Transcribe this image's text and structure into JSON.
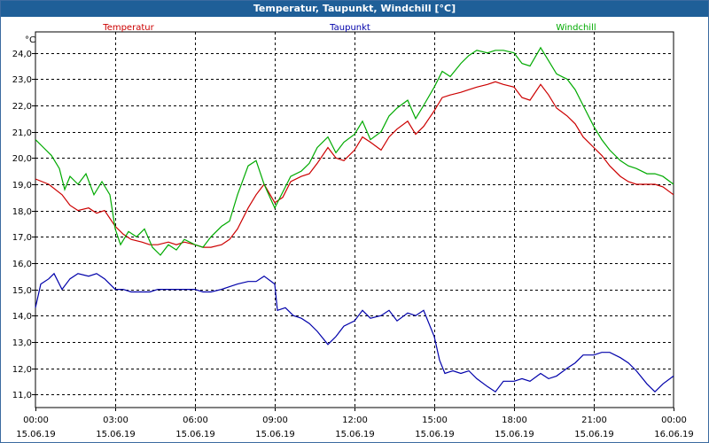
{
  "window": {
    "title": "Temperatur, Taupunkt, Windchill [°C]"
  },
  "chart_data": {
    "type": "line",
    "title": "Temperatur, Taupunkt, Windchill [°C]",
    "ylabel": "°C",
    "xlabel": "",
    "ylim": [
      10.5,
      24.8
    ],
    "y_ticks": [
      "11,0",
      "12,0",
      "13,0",
      "14,0",
      "15,0",
      "16,0",
      "17,0",
      "18,0",
      "19,0",
      "20,0",
      "21,0",
      "22,0",
      "23,0",
      "24,0"
    ],
    "x_ticks": [
      {
        "time": "00:00",
        "date": "15.06.19"
      },
      {
        "time": "03:00",
        "date": "15.06.19"
      },
      {
        "time": "06:00",
        "date": "15.06.19"
      },
      {
        "time": "09:00",
        "date": "15.06.19"
      },
      {
        "time": "12:00",
        "date": "15.06.19"
      },
      {
        "time": "15:00",
        "date": "15.06.19"
      },
      {
        "time": "18:00",
        "date": "15.06.19"
      },
      {
        "time": "21:00",
        "date": "15.06.19"
      },
      {
        "time": "00:00",
        "date": "16.06.19"
      }
    ],
    "grid": true,
    "legend_position": "top",
    "x_unit": "hours since 15.06.19 00:00",
    "series": [
      {
        "name": "Temperatur",
        "color": "#cc0000",
        "points": [
          [
            0,
            19.2
          ],
          [
            0.5,
            19.0
          ],
          [
            1,
            18.6
          ],
          [
            1.3,
            18.2
          ],
          [
            1.6,
            18.0
          ],
          [
            2,
            18.1
          ],
          [
            2.3,
            17.9
          ],
          [
            2.6,
            18.0
          ],
          [
            3,
            17.4
          ],
          [
            3.3,
            17.1
          ],
          [
            3.6,
            16.9
          ],
          [
            4,
            16.8
          ],
          [
            4.3,
            16.7
          ],
          [
            4.6,
            16.7
          ],
          [
            5,
            16.8
          ],
          [
            5.3,
            16.7
          ],
          [
            5.6,
            16.8
          ],
          [
            6,
            16.7
          ],
          [
            6.3,
            16.6
          ],
          [
            6.6,
            16.6
          ],
          [
            7,
            16.7
          ],
          [
            7.3,
            16.9
          ],
          [
            7.6,
            17.3
          ],
          [
            8,
            18.1
          ],
          [
            8.3,
            18.6
          ],
          [
            8.6,
            19.0
          ],
          [
            9,
            18.3
          ],
          [
            9.3,
            18.5
          ],
          [
            9.6,
            19.1
          ],
          [
            10,
            19.3
          ],
          [
            10.3,
            19.4
          ],
          [
            10.6,
            19.8
          ],
          [
            11,
            20.4
          ],
          [
            11.3,
            20.0
          ],
          [
            11.6,
            19.9
          ],
          [
            12,
            20.3
          ],
          [
            12.3,
            20.8
          ],
          [
            12.6,
            20.6
          ],
          [
            13,
            20.3
          ],
          [
            13.3,
            20.8
          ],
          [
            13.6,
            21.1
          ],
          [
            14,
            21.4
          ],
          [
            14.3,
            20.9
          ],
          [
            14.6,
            21.2
          ],
          [
            15,
            21.8
          ],
          [
            15.3,
            22.3
          ],
          [
            15.6,
            22.4
          ],
          [
            16,
            22.5
          ],
          [
            16.3,
            22.6
          ],
          [
            16.6,
            22.7
          ],
          [
            17,
            22.8
          ],
          [
            17.3,
            22.9
          ],
          [
            17.6,
            22.8
          ],
          [
            18,
            22.7
          ],
          [
            18.3,
            22.3
          ],
          [
            18.6,
            22.2
          ],
          [
            19,
            22.8
          ],
          [
            19.3,
            22.4
          ],
          [
            19.6,
            21.9
          ],
          [
            20,
            21.6
          ],
          [
            20.3,
            21.3
          ],
          [
            20.6,
            20.8
          ],
          [
            21,
            20.4
          ],
          [
            21.3,
            20.1
          ],
          [
            21.6,
            19.7
          ],
          [
            22,
            19.3
          ],
          [
            22.3,
            19.1
          ],
          [
            22.6,
            19.0
          ],
          [
            23,
            19.0
          ],
          [
            23.3,
            19.0
          ],
          [
            23.6,
            18.9
          ],
          [
            24,
            18.6
          ]
        ]
      },
      {
        "name": "Taupunkt",
        "color": "#0000aa",
        "points": [
          [
            0,
            14.3
          ],
          [
            0.2,
            15.2
          ],
          [
            0.5,
            15.4
          ],
          [
            0.7,
            15.6
          ],
          [
            1,
            15.0
          ],
          [
            1.3,
            15.4
          ],
          [
            1.6,
            15.6
          ],
          [
            2,
            15.5
          ],
          [
            2.3,
            15.6
          ],
          [
            2.6,
            15.4
          ],
          [
            3,
            15.0
          ],
          [
            3.3,
            15.0
          ],
          [
            3.6,
            14.9
          ],
          [
            4,
            14.9
          ],
          [
            4.3,
            14.9
          ],
          [
            4.6,
            15.0
          ],
          [
            5,
            15.0
          ],
          [
            5.3,
            15.0
          ],
          [
            5.6,
            15.0
          ],
          [
            6,
            15.0
          ],
          [
            6.3,
            14.9
          ],
          [
            6.6,
            14.9
          ],
          [
            7,
            15.0
          ],
          [
            7.3,
            15.1
          ],
          [
            7.6,
            15.2
          ],
          [
            8,
            15.3
          ],
          [
            8.3,
            15.3
          ],
          [
            8.6,
            15.5
          ],
          [
            9,
            15.2
          ],
          [
            9.1,
            14.2
          ],
          [
            9.4,
            14.3
          ],
          [
            9.7,
            14.0
          ],
          [
            10,
            13.9
          ],
          [
            10.3,
            13.7
          ],
          [
            10.6,
            13.4
          ],
          [
            11,
            12.9
          ],
          [
            11.3,
            13.2
          ],
          [
            11.6,
            13.6
          ],
          [
            12,
            13.8
          ],
          [
            12.3,
            14.2
          ],
          [
            12.6,
            13.9
          ],
          [
            13,
            14.0
          ],
          [
            13.3,
            14.2
          ],
          [
            13.6,
            13.8
          ],
          [
            14,
            14.1
          ],
          [
            14.3,
            14.0
          ],
          [
            14.6,
            14.2
          ],
          [
            15,
            13.2
          ],
          [
            15.2,
            12.3
          ],
          [
            15.4,
            11.8
          ],
          [
            15.7,
            11.9
          ],
          [
            16,
            11.8
          ],
          [
            16.3,
            11.9
          ],
          [
            16.6,
            11.6
          ],
          [
            17,
            11.3
          ],
          [
            17.3,
            11.1
          ],
          [
            17.6,
            11.5
          ],
          [
            18,
            11.5
          ],
          [
            18.3,
            11.6
          ],
          [
            18.6,
            11.5
          ],
          [
            19,
            11.8
          ],
          [
            19.3,
            11.6
          ],
          [
            19.6,
            11.7
          ],
          [
            20,
            12.0
          ],
          [
            20.3,
            12.2
          ],
          [
            20.6,
            12.5
          ],
          [
            21,
            12.5
          ],
          [
            21.3,
            12.6
          ],
          [
            21.6,
            12.6
          ],
          [
            22,
            12.4
          ],
          [
            22.3,
            12.2
          ],
          [
            22.6,
            11.9
          ],
          [
            23,
            11.4
          ],
          [
            23.3,
            11.1
          ],
          [
            23.6,
            11.4
          ],
          [
            24,
            11.7
          ]
        ]
      },
      {
        "name": "Windchill",
        "color": "#00aa00",
        "points": [
          [
            0,
            20.7
          ],
          [
            0.3,
            20.4
          ],
          [
            0.6,
            20.1
          ],
          [
            0.9,
            19.6
          ],
          [
            1.1,
            18.8
          ],
          [
            1.3,
            19.3
          ],
          [
            1.6,
            19.0
          ],
          [
            1.9,
            19.4
          ],
          [
            2.2,
            18.6
          ],
          [
            2.5,
            19.1
          ],
          [
            2.8,
            18.6
          ],
          [
            3,
            17.3
          ],
          [
            3.2,
            16.7
          ],
          [
            3.5,
            17.2
          ],
          [
            3.8,
            17.0
          ],
          [
            4.1,
            17.3
          ],
          [
            4.4,
            16.6
          ],
          [
            4.7,
            16.3
          ],
          [
            5,
            16.7
          ],
          [
            5.3,
            16.5
          ],
          [
            5.6,
            16.9
          ],
          [
            6,
            16.7
          ],
          [
            6.3,
            16.6
          ],
          [
            6.6,
            17.0
          ],
          [
            7,
            17.4
          ],
          [
            7.3,
            17.6
          ],
          [
            7.6,
            18.6
          ],
          [
            8,
            19.7
          ],
          [
            8.3,
            19.9
          ],
          [
            8.6,
            19.0
          ],
          [
            9,
            18.1
          ],
          [
            9.3,
            18.7
          ],
          [
            9.6,
            19.3
          ],
          [
            10,
            19.5
          ],
          [
            10.3,
            19.8
          ],
          [
            10.6,
            20.4
          ],
          [
            11,
            20.8
          ],
          [
            11.3,
            20.2
          ],
          [
            11.6,
            20.6
          ],
          [
            12,
            20.9
          ],
          [
            12.3,
            21.4
          ],
          [
            12.6,
            20.7
          ],
          [
            13,
            21.0
          ],
          [
            13.3,
            21.6
          ],
          [
            13.6,
            21.9
          ],
          [
            14,
            22.2
          ],
          [
            14.3,
            21.5
          ],
          [
            14.6,
            22.0
          ],
          [
            15,
            22.7
          ],
          [
            15.3,
            23.3
          ],
          [
            15.6,
            23.1
          ],
          [
            16,
            23.6
          ],
          [
            16.3,
            23.9
          ],
          [
            16.6,
            24.1
          ],
          [
            17,
            24.0
          ],
          [
            17.3,
            24.1
          ],
          [
            17.6,
            24.1
          ],
          [
            18,
            24.0
          ],
          [
            18.3,
            23.6
          ],
          [
            18.6,
            23.5
          ],
          [
            19,
            24.2
          ],
          [
            19.3,
            23.7
          ],
          [
            19.6,
            23.2
          ],
          [
            20,
            23.0
          ],
          [
            20.3,
            22.6
          ],
          [
            20.6,
            22.0
          ],
          [
            21,
            21.2
          ],
          [
            21.3,
            20.7
          ],
          [
            21.6,
            20.3
          ],
          [
            22,
            19.9
          ],
          [
            22.3,
            19.7
          ],
          [
            22.6,
            19.6
          ],
          [
            23,
            19.4
          ],
          [
            23.3,
            19.4
          ],
          [
            23.6,
            19.3
          ],
          [
            24,
            19.0
          ]
        ]
      }
    ]
  }
}
